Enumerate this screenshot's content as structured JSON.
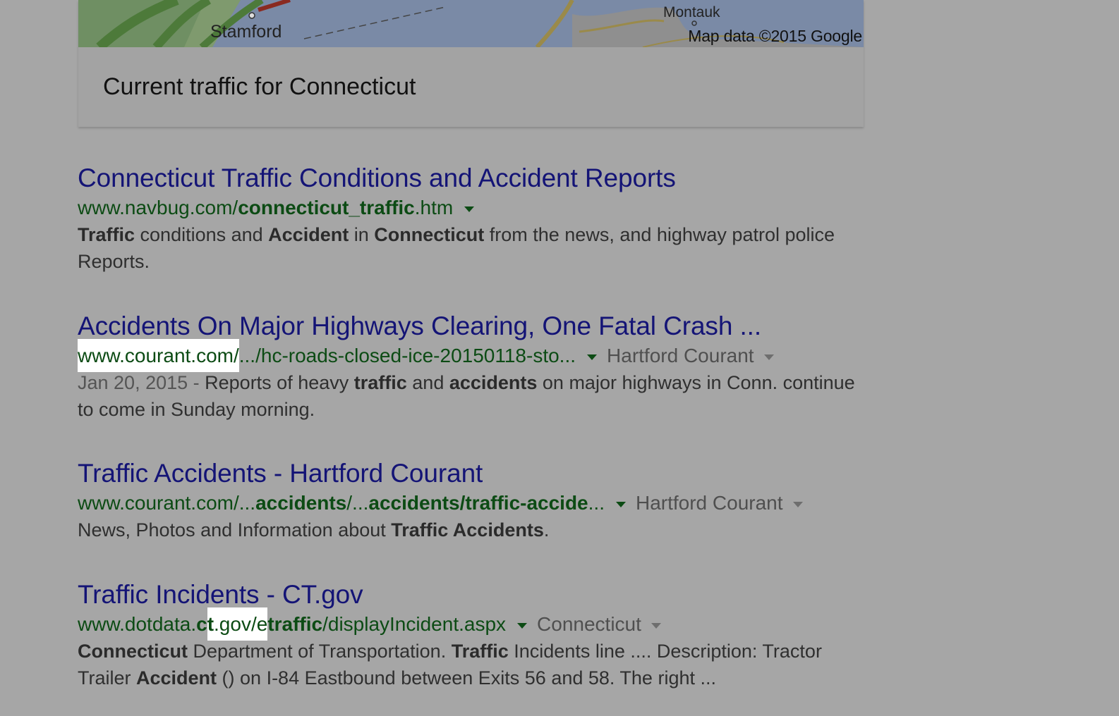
{
  "map": {
    "place_stamford": "Stamford",
    "place_montauk": "Montauk",
    "credit": "Map data ©2015 Google",
    "caption": "Current traffic for Connecticut"
  },
  "results": [
    {
      "title": "Connecticut Traffic Conditions and Accident Reports",
      "url_a": "www.navbug.com/",
      "url_b": "connecticut_traffic",
      "url_c": ".htm",
      "snippet": {
        "s1": "Traffic",
        "s2": " conditions and ",
        "s3": "Accident",
        "s4": " in ",
        "s5": "Connecticut",
        "s6": " from the news, and highway patrol police Reports."
      }
    },
    {
      "title": "Accidents On Major Highways Clearing, One Fatal Crash ...",
      "url_a": "www.courant.com/",
      "url_b": ".../hc-roads-closed-ice-20150118-sto...",
      "source": "Hartford Courant",
      "date": "Jan 20, 2015 - ",
      "snippet": {
        "s1": "Reports of heavy ",
        "s2": "traffic",
        "s3": " and ",
        "s4": "accidents",
        "s5": " on major highways in Conn. continue to come in Sunday morning."
      }
    },
    {
      "title": "Traffic Accidents - Hartford Courant",
      "url_a": "www.courant.com/...",
      "url_b": "accidents",
      "url_c": "/...",
      "url_d": "accidents/traffic-accide",
      "url_e": "...",
      "source": "Hartford Courant",
      "snippet": {
        "s1": "News, Photos and Information about ",
        "s2": "Traffic Accidents",
        "s3": "."
      }
    },
    {
      "title": "Traffic Incidents - CT.gov",
      "url_a": "www.dotdata.",
      "url_b": "c",
      "url_c": "t",
      "url_d": ".gov/e",
      "url_e": "traffic",
      "url_f": "/displayIncident.aspx",
      "source": "Connecticut",
      "snippet": {
        "s1": "Connecticut",
        "s2": " Department of Transportation. ",
        "s3": "Traffic",
        "s4": " Incidents line .... Description: Tractor Trailer ",
        "s5": "Accident",
        "s6": " () on I-84 Eastbound between Exits 56 and 58. The right ..."
      }
    }
  ],
  "colors": {
    "link_title": "#141476",
    "url_green": "#0c4b14",
    "background_dimmed": "#a6a6a6",
    "highlight": "#ffffff"
  },
  "icons": [
    "dropdown-caret-icon"
  ]
}
